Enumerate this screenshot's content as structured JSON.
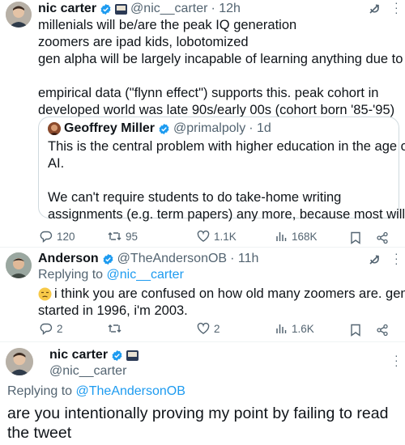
{
  "tweet1": {
    "name": "nic carter",
    "handle": "@nic__carter",
    "time": "· 12h",
    "lines": [
      "millenials will be/are the peak IQ generation",
      "zoomers are ipad kids, lobotomized",
      "gen alpha will be largely incapable of learning anything due to AI",
      "empirical data (\"flynn effect\") supports this. peak cohort in",
      "developed world was late 90s/early 00s (cohort born '85-'95)"
    ],
    "quote": {
      "name": "Geoffrey Miller",
      "handle": "@primalpoly",
      "time": "· 1d",
      "lines": [
        "This is the central problem with higher education in the age of",
        "AI.",
        "We can't require students to do take-home writing",
        "assignments (e.g. term papers) any more, because most will ..."
      ]
    },
    "stats": {
      "replies": "120",
      "reposts": "95",
      "likes": "1.1K",
      "views": "168K"
    }
  },
  "tweet2": {
    "name": "Anderson",
    "handle": "@TheAndersonOB",
    "time": "· 11h",
    "replying_prefix": "Replying to",
    "replying_to": "@nic__carter",
    "lines": [
      "i think you are confused on how old many zoomers are. gen",
      "started in 1996, i'm 2003."
    ],
    "stats": {
      "replies": "2",
      "reposts": "",
      "likes": "2",
      "views": "1.6K"
    }
  },
  "tweet3": {
    "name": "nic carter",
    "handle": "@nic__carter",
    "replying_prefix": "Replying to",
    "replying_to": "@TheAndersonOB",
    "lines": [
      "are you intentionally proving my point by failing to read",
      "the tweet"
    ]
  },
  "colors": {
    "verified": "#1d9bf0",
    "link": "#1d9bf0",
    "muted": "#536471"
  },
  "icons": [
    "verified-badge-icon",
    "grok-icon",
    "more-icon",
    "reply-icon",
    "repost-icon",
    "like-icon",
    "views-icon",
    "bookmark-icon",
    "share-icon"
  ]
}
